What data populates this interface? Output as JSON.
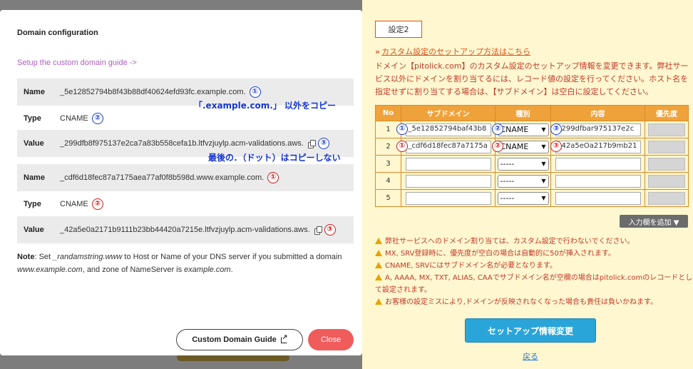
{
  "modal": {
    "title": "Domain configuration",
    "guide_link": "Setup the custom domain guide ->",
    "rows": [
      {
        "key": "Name",
        "value": "_5e12852794b8f43b88df40624efd93fc.example.com.",
        "badge": "①",
        "badge_color": "blue"
      },
      {
        "key": "Type",
        "value": "CNAME",
        "badge": "②",
        "badge_color": "blue"
      },
      {
        "key": "Value",
        "value": "_299dfb8f975137e2ca7a83b558cefa1b.ltfvzjuylp.acm-validations.aws.",
        "badge": "③",
        "badge_color": "blue"
      },
      {
        "key": "Name",
        "value": "_cdf6d18fec87a7175aea77af0f8b598d.www.example.com.",
        "badge": "①",
        "badge_color": "red"
      },
      {
        "key": "Type",
        "value": "CNAME",
        "badge": "②",
        "badge_color": "red"
      },
      {
        "key": "Value",
        "value": "_42a5e0a2171b9111b23bb44420a7215e.ltfvzjuylp.acm-validations.aws.",
        "badge": "③",
        "badge_color": "red"
      }
    ],
    "note_label": "Note",
    "note_parts": [
      ": Set ",
      "_randamstring.www",
      " to Host or Name of your DNS server if you submitted a domain ",
      "www.example.com",
      ", and zone of NameServer is ",
      "example.com",
      "."
    ],
    "btn_guide": "Custom Domain Guide",
    "btn_close": "Close"
  },
  "annotations": {
    "copy_except": "「.example.com.」 以外をコピー",
    "no_dot": "最後の．（ドット）はコピーしない"
  },
  "panel": {
    "tag": "設定2",
    "chev": "»",
    "setup_link": "カスタム設定のセットアップ方法はこちら",
    "desc": "ドメイン【pitolick.com】のカスタム設定のセットアップ情報を変更できます。弊社サービス以外にドメインを割り当てるには、レコード値の設定を行ってください。ホスト名を指定せずに割り当てする場合は、【サブドメイン】は空白に設定してください。",
    "headers": [
      "No",
      "サブドメイン",
      "種別",
      "内容",
      "優先度"
    ],
    "rows": [
      {
        "no": "1",
        "sub": "_5e12852794baf43b8",
        "type": "CNAME",
        "content": "_299dfbar975137e2c",
        "color": "blue"
      },
      {
        "no": "2",
        "sub": "_cdf6d18fec87a7175a",
        "type": "CNAME",
        "content": "_42a5eOa217b9mb21",
        "color": "red"
      },
      {
        "no": "3",
        "sub": "",
        "type": "-----",
        "content": ""
      },
      {
        "no": "4",
        "sub": "",
        "type": "-----",
        "content": ""
      },
      {
        "no": "5",
        "sub": "",
        "type": "-----",
        "content": ""
      }
    ],
    "btn_add": "入力欄を追加 ▼",
    "notes": [
      "弊社サービスへのドメイン割り当ては、カスタム設定で行わないでください。",
      "MX, SRV登録時に、優先度が空白の場合は自動的に50が挿入されます。",
      "CNAME, SRVにはサブドメイン名が必要となります。",
      "A, AAAA, MX, TXT, ALIAS, CAAでサブドメイン名が空欄の場合はpitolick.comのレコードとして設定されます。",
      "お客様の設定ミスにより,ドメインが反映されなくなった場合も責任は負いかねます。"
    ],
    "btn_submit": "セットアップ情報変更",
    "back": "戻る"
  },
  "colors": {
    "accent_orange": "#f0a23a",
    "close_red": "#f05b5b",
    "submit_blue": "#2aa5d9",
    "badge_blue": "#1a3bd8",
    "badge_red": "#d11a1a"
  }
}
